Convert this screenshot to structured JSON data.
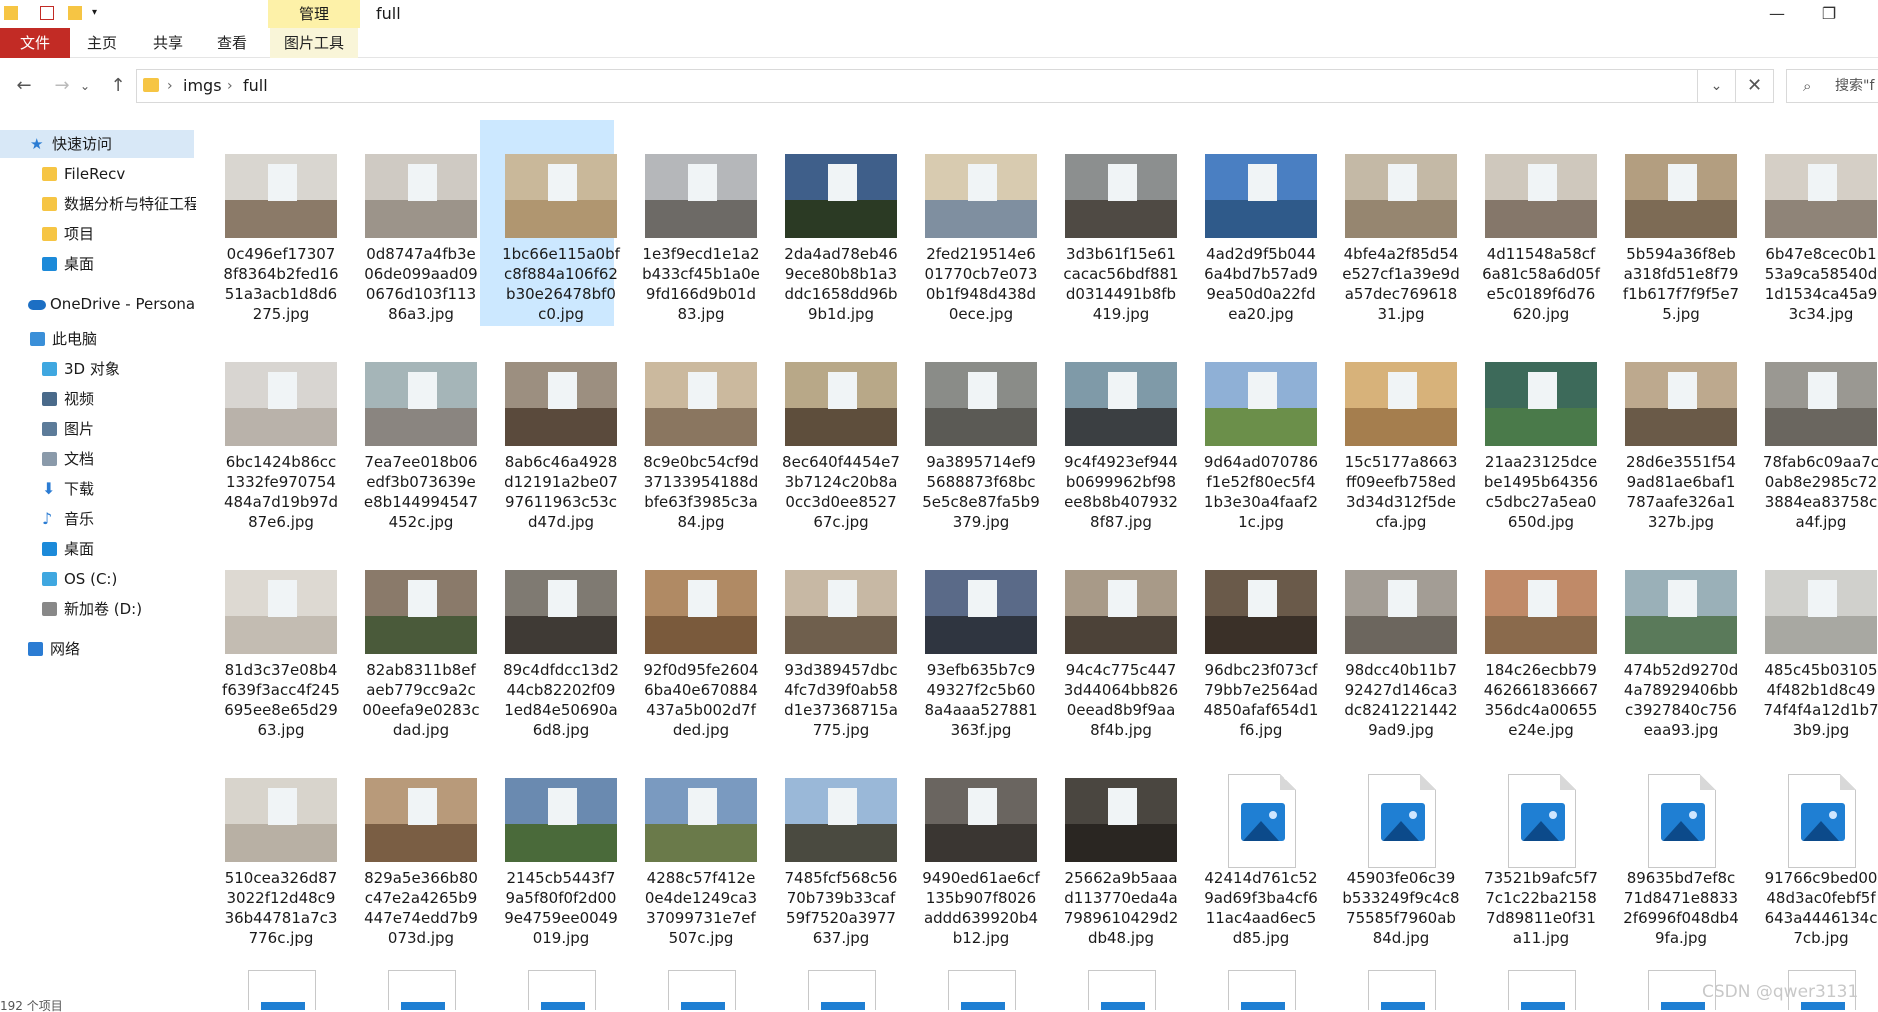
{
  "window": {
    "title": "full",
    "ribbon_context_label": "管理",
    "minimize_glyph": "—",
    "maximize_glyph": "❐"
  },
  "ribbon_tabs": [
    {
      "label": "文件"
    },
    {
      "label": "主页"
    },
    {
      "label": "共享"
    },
    {
      "label": "查看"
    },
    {
      "label": "图片工具"
    }
  ],
  "navigation": {
    "back_glyph": "←",
    "forward_glyph": "→",
    "recent_glyph": "⌄",
    "up_glyph": "↑",
    "breadcrumb": [
      "imgs",
      "full"
    ],
    "separator": "›",
    "dropdown_glyph": "⌄",
    "clear_glyph": "✕",
    "search_glyph": "⌕",
    "search_placeholder": "搜索\"f"
  },
  "sidebar": {
    "items": [
      {
        "label": "快速访问",
        "icon": "star-icon",
        "color": "#2b7cd3"
      },
      {
        "label": "FileRecv",
        "icon": "folder-icon",
        "color": "#f6c544"
      },
      {
        "label": "数据分析与特征工程",
        "icon": "folder-icon",
        "color": "#f6c544"
      },
      {
        "label": "项目",
        "icon": "folder-icon",
        "color": "#f6c544"
      },
      {
        "label": "桌面",
        "icon": "desktop-icon",
        "color": "#1c8ad9"
      },
      {
        "label": "OneDrive - Persona",
        "icon": "cloud-icon",
        "color": "#1c6fc4"
      },
      {
        "label": "此电脑",
        "icon": "computer-icon",
        "color": "#3a8fd8"
      },
      {
        "label": "3D 对象",
        "icon": "cube-icon",
        "color": "#3fa7e0"
      },
      {
        "label": "视频",
        "icon": "video-icon",
        "color": "#4a6a8a"
      },
      {
        "label": "图片",
        "icon": "picture-icon",
        "color": "#5c7b99"
      },
      {
        "label": "文档",
        "icon": "document-icon",
        "color": "#8a9aaa"
      },
      {
        "label": "下载",
        "icon": "download-icon",
        "color": "#2b7cd3"
      },
      {
        "label": "音乐",
        "icon": "music-icon",
        "color": "#2b7cd3"
      },
      {
        "label": "桌面",
        "icon": "desktop-icon",
        "color": "#1c8ad9"
      },
      {
        "label": "OS (C:)",
        "icon": "drive-icon",
        "color": "#3fa7e0"
      },
      {
        "label": "新加卷 (D:)",
        "icon": "drive-icon",
        "color": "#888888"
      },
      {
        "label": "网络",
        "icon": "network-icon",
        "color": "#2b7cd3"
      }
    ]
  },
  "files": [
    {
      "name": "0c496ef173078f8364b2fed1651a3acb1d8d6275.jpg",
      "kind": "photo",
      "wall": "#d9d6d0",
      "floor": "#8b7a68"
    },
    {
      "name": "0d8747a4fb3e06de099aad090676d103f11386a3.jpg",
      "kind": "photo",
      "wall": "#cfcac3",
      "floor": "#9c948a"
    },
    {
      "name": "1bc66e115a0bfc8f884a106f62b30e26478bf0c0.jpg",
      "kind": "photo",
      "wall": "#c9b89a",
      "floor": "#b09670"
    },
    {
      "name": "1e3f9ecd1e1a2b433cf45b1a0e9fd166d9b01d83.jpg",
      "kind": "photo",
      "wall": "#b5b7ba",
      "floor": "#6d6a66"
    },
    {
      "name": "2da4ad78eb469ece80b8b1a3ddc1658dd96b9b1d.jpg",
      "kind": "photo",
      "wall": "#3f5f8a",
      "floor": "#2b3a24"
    },
    {
      "name": "2fed219514e601770cb7e0730b1f948d438d0ece.jpg",
      "kind": "photo",
      "wall": "#d8cbb0",
      "floor": "#7f8fa0"
    },
    {
      "name": "3d3b61f15e61cacac56bdf881d0314491b8fb419.jpg",
      "kind": "photo",
      "wall": "#8c8f8f",
      "floor": "#4f4a44"
    },
    {
      "name": "4ad2d9f5b0446a4bd7b57ad99ea50d0a22fdea20.jpg",
      "kind": "photo",
      "wall": "#4a7fc2",
      "floor": "#2f5a8a"
    },
    {
      "name": "4bfe4a2f85d54e527cf1a39e9da57dec76961831.jpg",
      "kind": "photo",
      "wall": "#c4b9a6",
      "floor": "#968670"
    },
    {
      "name": "4d11548a58cf6a81c58a6d05fe5c0189f6d76620.jpg",
      "kind": "photo",
      "wall": "#cfc8bd",
      "floor": "#85776a"
    },
    {
      "name": "5b594a36f8eba318fd51e8f79f1b617f7f9f5e75.jpg",
      "kind": "photo",
      "wall": "#b39e80",
      "floor": "#7d6b55"
    },
    {
      "name": "6b47e8cec0b153a9ca58540d1d1534ca45a93c34.jpg",
      "kind": "photo",
      "wall": "#d5cfc6",
      "floor": "#8f8478"
    },
    {
      "name": "6bc1424b86cc1332fe970754484a7d19b97d87e6.jpg",
      "kind": "photo",
      "wall": "#d8d5d1",
      "floor": "#b9b2aa"
    },
    {
      "name": "7ea7ee018b06edf3b073639ee8b144994547452c.jpg",
      "kind": "photo",
      "wall": "#a5b5b8",
      "floor": "#8a8580"
    },
    {
      "name": "8ab6c46a4928d12191a2be0797611963c53cd47d.jpg",
      "kind": "photo",
      "wall": "#9c8f80",
      "floor": "#5a4a3c"
    },
    {
      "name": "8c9e0bc54cf9d37133954188dbfe63f3985c3a84.jpg",
      "kind": "photo",
      "wall": "#cbb99e",
      "floor": "#8a7660"
    },
    {
      "name": "8ec640f4454e73b7124c20b8a0cc3d0ee852767c.jpg",
      "kind": "photo",
      "wall": "#b8a888",
      "floor": "#5e4e3c"
    },
    {
      "name": "9a3895714ef95688873f68bc5e5c8e87fa5b9379.jpg",
      "kind": "photo",
      "wall": "#8a8c88",
      "floor": "#5b5a55"
    },
    {
      "name": "9c4f4923ef944b0699962bf98ee8b8b4079328f87.jpg",
      "kind": "photo",
      "wall": "#7f9aa8",
      "floor": "#3b3f42"
    },
    {
      "name": "9d64ad070786f1e52f80ec5f41b3e30a4faaf21c.jpg",
      "kind": "photo",
      "wall": "#8fb0d6",
      "floor": "#6b8f4a"
    },
    {
      "name": "15c5177a8663ff09eefb758ed3d34d312f5decfa.jpg",
      "kind": "photo",
      "wall": "#d7b27a",
      "floor": "#a57e4e"
    },
    {
      "name": "21aa23125dcebe1495b64356c5dbc27a5ea0650d.jpg",
      "kind": "photo",
      "wall": "#3d6a5a",
      "floor": "#4a7a4a"
    },
    {
      "name": "28d6e3551f549ad81ae6baf1787aafe326a1327b.jpg",
      "kind": "photo",
      "wall": "#bda98e",
      "floor": "#6a5a48"
    },
    {
      "name": "78fab6c09aa7c0ab8e2985c723884ea83758ca4f.jpg",
      "kind": "photo",
      "wall": "#9a9892",
      "floor": "#6a665f"
    },
    {
      "name": "81d3c37e08b4f639f3acc4f245695ee8e65d2963.jpg",
      "kind": "photo",
      "wall": "#ddd9d2",
      "floor": "#c3bcb2"
    },
    {
      "name": "82ab8311b8efaeb779cc9a2c00eefa9e0283cdad.jpg",
      "kind": "photo",
      "wall": "#8a7a6a",
      "floor": "#4a5a3a"
    },
    {
      "name": "89c4dfdcc13d244cb82202f091ed84e50690a6d8.jpg",
      "kind": "photo",
      "wall": "#7f7a72",
      "floor": "#3f3a35"
    },
    {
      "name": "92f0d95fe26046ba40e670884437a5b002d7fded.jpg",
      "kind": "photo",
      "wall": "#b08a64",
      "floor": "#7a5a3c"
    },
    {
      "name": "93d389457dbc4fc7d39f0ab58d1e37368715a775.jpg",
      "kind": "photo",
      "wall": "#c7b8a4",
      "floor": "#6f5f4d"
    },
    {
      "name": "93efb635b7c949327f2c5b608a4aaa527881363f.jpg",
      "kind": "photo",
      "wall": "#5a6a88",
      "floor": "#2f3540"
    },
    {
      "name": "94c4c775c4473d44064bb8260eead8b9f9aa8f4b.jpg",
      "kind": "photo",
      "wall": "#a89a88",
      "floor": "#4c4238"
    },
    {
      "name": "96dbc23f073cf79bb7e2564ad4850afaf654d1f6.jpg",
      "kind": "photo",
      "wall": "#6a5a4a",
      "floor": "#3a3028"
    },
    {
      "name": "98dcc40b11b792427d146ca3dc82412214429ad9.jpg",
      "kind": "photo",
      "wall": "#a39d95",
      "floor": "#6c665e"
    },
    {
      "name": "184c26ecbb79462661836667356dc4a00655e24e.jpg",
      "kind": "photo",
      "wall": "#c08a68",
      "floor": "#8a6a4c"
    },
    {
      "name": "474b52d9270d4a78929406bbc3927840c756eaa93.jpg",
      "kind": "photo",
      "wall": "#9ab0b8",
      "floor": "#5a7a5a"
    },
    {
      "name": "485c45b031054f482b1d8c4974f4f4a12d1b73b9.jpg",
      "kind": "photo",
      "wall": "#d0d0cc",
      "floor": "#a8a8a2"
    },
    {
      "name": "510cea326d873022f12d48c936b44781a7c3776c.jpg",
      "kind": "photo",
      "wall": "#d8d4cc",
      "floor": "#b8b0a4"
    },
    {
      "name": "829a5e366b80c47e2a4265b9447e74edd7b9073d.jpg",
      "kind": "photo",
      "wall": "#b89a7a",
      "floor": "#7a5e44"
    },
    {
      "name": "2145cb5443f79a5f80f0f2d009e4759ee0049019.jpg",
      "kind": "photo",
      "wall": "#6a8ab0",
      "floor": "#4a6a3a"
    },
    {
      "name": "4288c57f412e0e4de1249ca337099731e7ef507c.jpg",
      "kind": "photo",
      "wall": "#7a9ac0",
      "floor": "#6a7a4a"
    },
    {
      "name": "7485fcf568c5670b739b33caf59f7520a3977637.jpg",
      "kind": "photo",
      "wall": "#9ab8d8",
      "floor": "#4a4a40"
    },
    {
      "name": "9490ed61ae6cf135b907f8026addd639920b4b12.jpg",
      "kind": "photo",
      "wall": "#6a6560",
      "floor": "#3a3632"
    },
    {
      "name": "25662a9b5aaad113770eda4a7989610429d2db48.jpg",
      "kind": "photo",
      "wall": "#4a4640",
      "floor": "#2a2622"
    },
    {
      "name": "42414d761c529ad69f3ba4cf611ac4aad6ec5d85.jpg",
      "kind": "icon"
    },
    {
      "name": "45903fe06c39b533249f9c4c875585f7960ab84d.jpg",
      "kind": "icon"
    },
    {
      "name": "73521b9afc5f77c1c22ba21587d89811e0f31a11.jpg",
      "kind": "icon"
    },
    {
      "name": "89635bd7ef8c71d8471e88332f6996f048db49fa.jpg",
      "kind": "icon"
    },
    {
      "name": "91766c9bed0048d3ac0febf5f643a4446134c7cb.jpg",
      "kind": "icon"
    }
  ],
  "status": {
    "item_count": "192 个项目"
  },
  "watermark": "CSDN @qwer3131"
}
